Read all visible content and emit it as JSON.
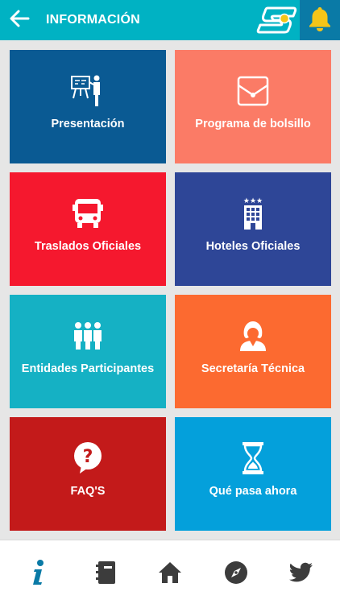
{
  "header": {
    "title": "INFORMACIÓN",
    "back_icon": "arrow-left-icon",
    "notification_icon": "bell-icon",
    "colors": {
      "bar": "#00b2c3",
      "bell_bg": "#0a7aa6",
      "bell": "#f5c518"
    }
  },
  "tiles": [
    {
      "label": "Presentación",
      "icon": "presentation-icon",
      "color": "#0a5a93"
    },
    {
      "label": "Programa de bolsillo",
      "icon": "envelope-icon",
      "color": "#fb7b66"
    },
    {
      "label": "Traslados Oficiales",
      "icon": "bus-icon",
      "color": "#f5182e"
    },
    {
      "label": "Hoteles Oficiales",
      "icon": "hotel-icon",
      "color": "#2e4697"
    },
    {
      "label": "Entidades Participantes",
      "icon": "group-icon",
      "color": "#15b1c4"
    },
    {
      "label": "Secretaría Técnica",
      "icon": "secretary-icon",
      "color": "#fc6a30"
    },
    {
      "label": "FAQ'S",
      "icon": "faq-bubble-icon",
      "color": "#c31a1a"
    },
    {
      "label": "Qué pasa ahora",
      "icon": "hourglass-icon",
      "color": "#04a0db"
    }
  ],
  "bottom_nav": [
    {
      "icon": "info-icon",
      "active": true
    },
    {
      "icon": "agenda-icon",
      "active": false
    },
    {
      "icon": "home-icon",
      "active": false
    },
    {
      "icon": "compass-icon",
      "active": false
    },
    {
      "icon": "twitter-icon",
      "active": false
    }
  ],
  "nav_colors": {
    "active": "#0a7aa6",
    "inactive": "#3c3c3c"
  }
}
